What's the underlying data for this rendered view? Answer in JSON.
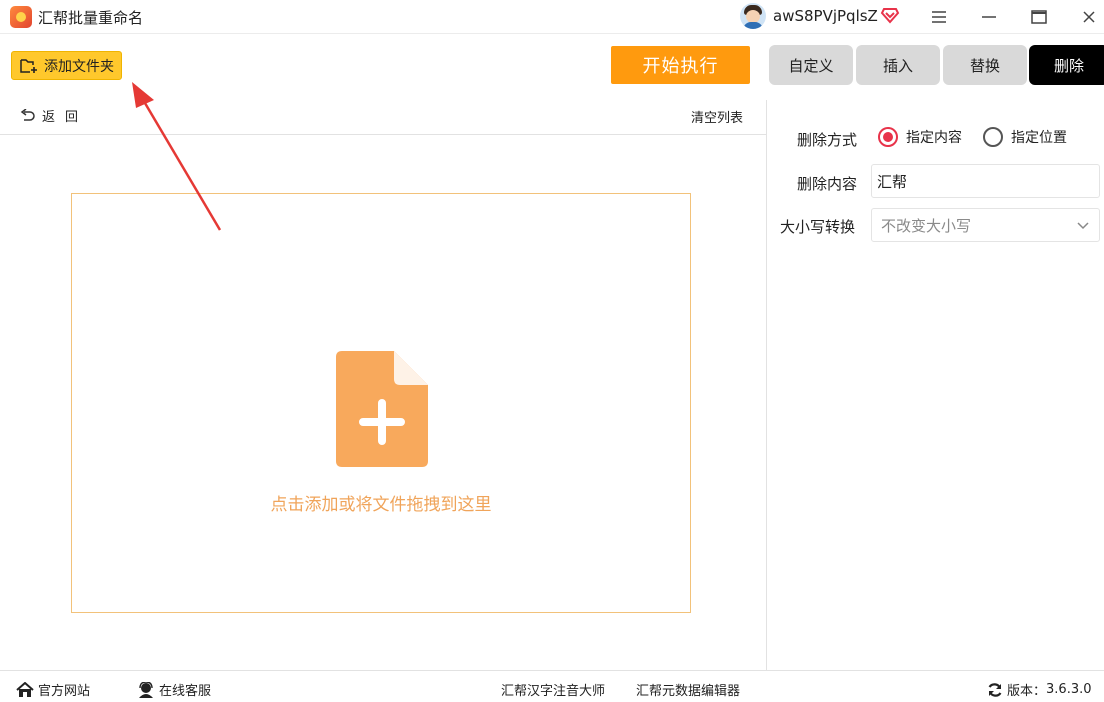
{
  "window": {
    "title": "汇帮批量重命名",
    "username": "awS8PVjPqlsZ",
    "icons": [
      "app-logo",
      "avatar",
      "vip-diamond-icon",
      "menu-icon",
      "minimize-icon",
      "maximize-icon",
      "close-icon"
    ]
  },
  "toolbar": {
    "add_folder_label": "添加文件夹",
    "start_label": "开始执行"
  },
  "tabs": [
    {
      "label": "自定义",
      "active": false
    },
    {
      "label": "插入",
      "active": false
    },
    {
      "label": "替换",
      "active": false
    },
    {
      "label": "删除",
      "active": true
    }
  ],
  "list": {
    "back_label": "返回",
    "clear_label": "清空列表",
    "drop_hint": "点击添加或将文件拖拽到这里"
  },
  "settings": {
    "mode_label": "删除方式",
    "mode_options": [
      {
        "label": "指定内容",
        "checked": true
      },
      {
        "label": "指定位置",
        "checked": false
      }
    ],
    "content_label": "删除内容",
    "content_value": "汇帮",
    "case_label": "大小写转换",
    "case_value": "不改变大小写"
  },
  "footer": {
    "site_label": "官方网站",
    "service_label": "在线客服",
    "hanzi_label": "汇帮汉字注音大师",
    "meta_label": "汇帮元数据编辑器",
    "version_label": "版本：",
    "version": "3.6.3.0"
  },
  "colors": {
    "accent_yellow": "#ffc82c",
    "start_orange": "#ff9a0e",
    "radio_red": "#e8334a",
    "dropzone_border": "#f2c27a",
    "file_icon": "#f8a95c",
    "drop_text": "#f0a45a",
    "active_tab": "#000000"
  }
}
